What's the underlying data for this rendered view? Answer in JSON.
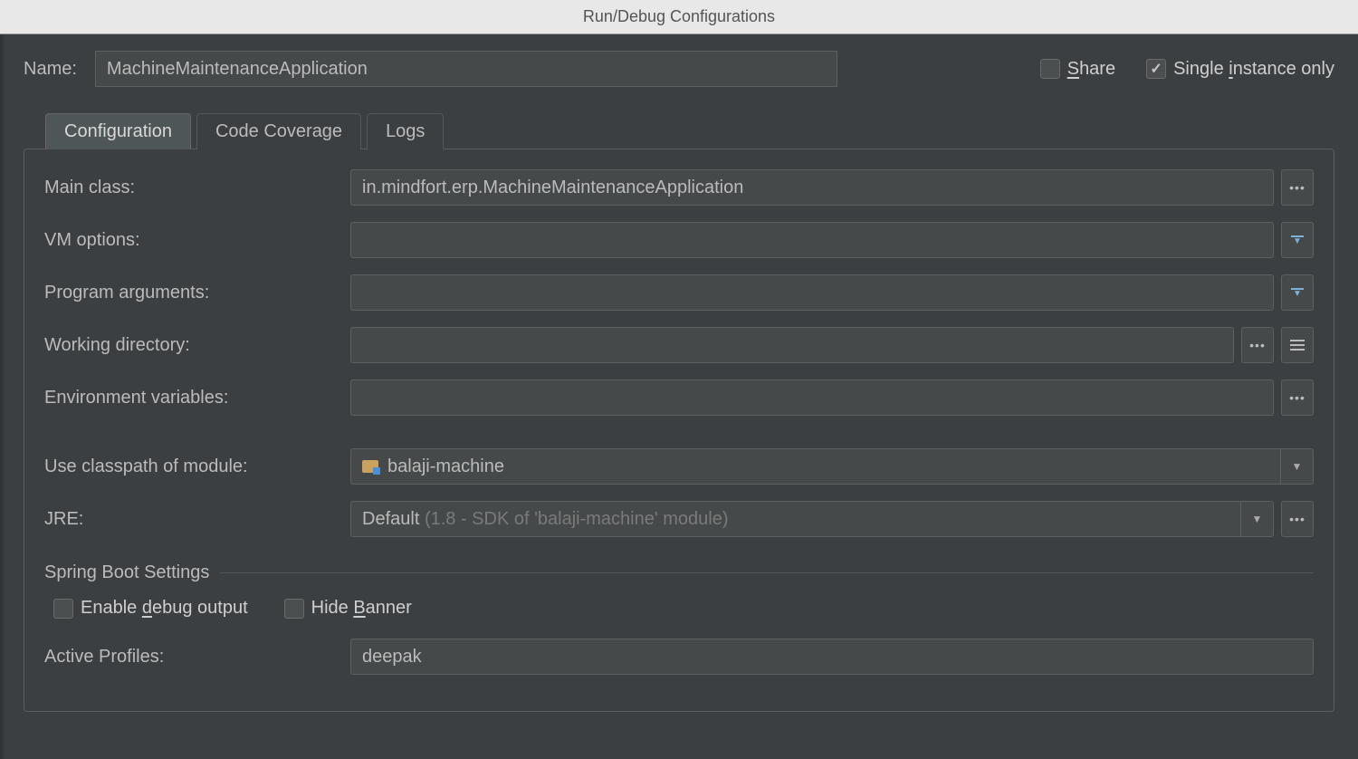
{
  "window": {
    "title": "Run/Debug Configurations"
  },
  "header": {
    "name_label": "Name:",
    "name_value": "MachineMaintenanceApplication",
    "share_label_pre": "S",
    "share_label_post": "hare",
    "single_pre": "Single ",
    "single_u": "i",
    "single_post": "nstance only"
  },
  "tabs": {
    "configuration": "Configuration",
    "code_coverage": "Code Coverage",
    "logs": "Logs"
  },
  "form": {
    "main_class_label": "Main class:",
    "main_class_value": "in.mindfort.erp.MachineMaintenanceApplication",
    "vm_options_label": "VM options:",
    "vm_options_value": "",
    "program_args_label": "Program arguments:",
    "program_args_value": "",
    "working_dir_label": "Working directory:",
    "working_dir_value": "",
    "env_vars_label": "Environment variables:",
    "env_vars_value": "",
    "classpath_label": "Use classpath of module:",
    "classpath_value": "balaji-machine",
    "jre_label": "JRE:",
    "jre_value_main": "Default ",
    "jre_value_muted": "(1.8 - SDK of 'balaji-machine' module)"
  },
  "spring": {
    "section_title": "Spring Boot Settings",
    "enable_debug_pre": "Enable ",
    "enable_debug_u": "d",
    "enable_debug_post": "ebug output",
    "hide_banner_pre": "Hide ",
    "hide_banner_u": "B",
    "hide_banner_post": "anner",
    "active_profiles_label": "Active Profiles:",
    "active_profiles_value": "deepak"
  }
}
